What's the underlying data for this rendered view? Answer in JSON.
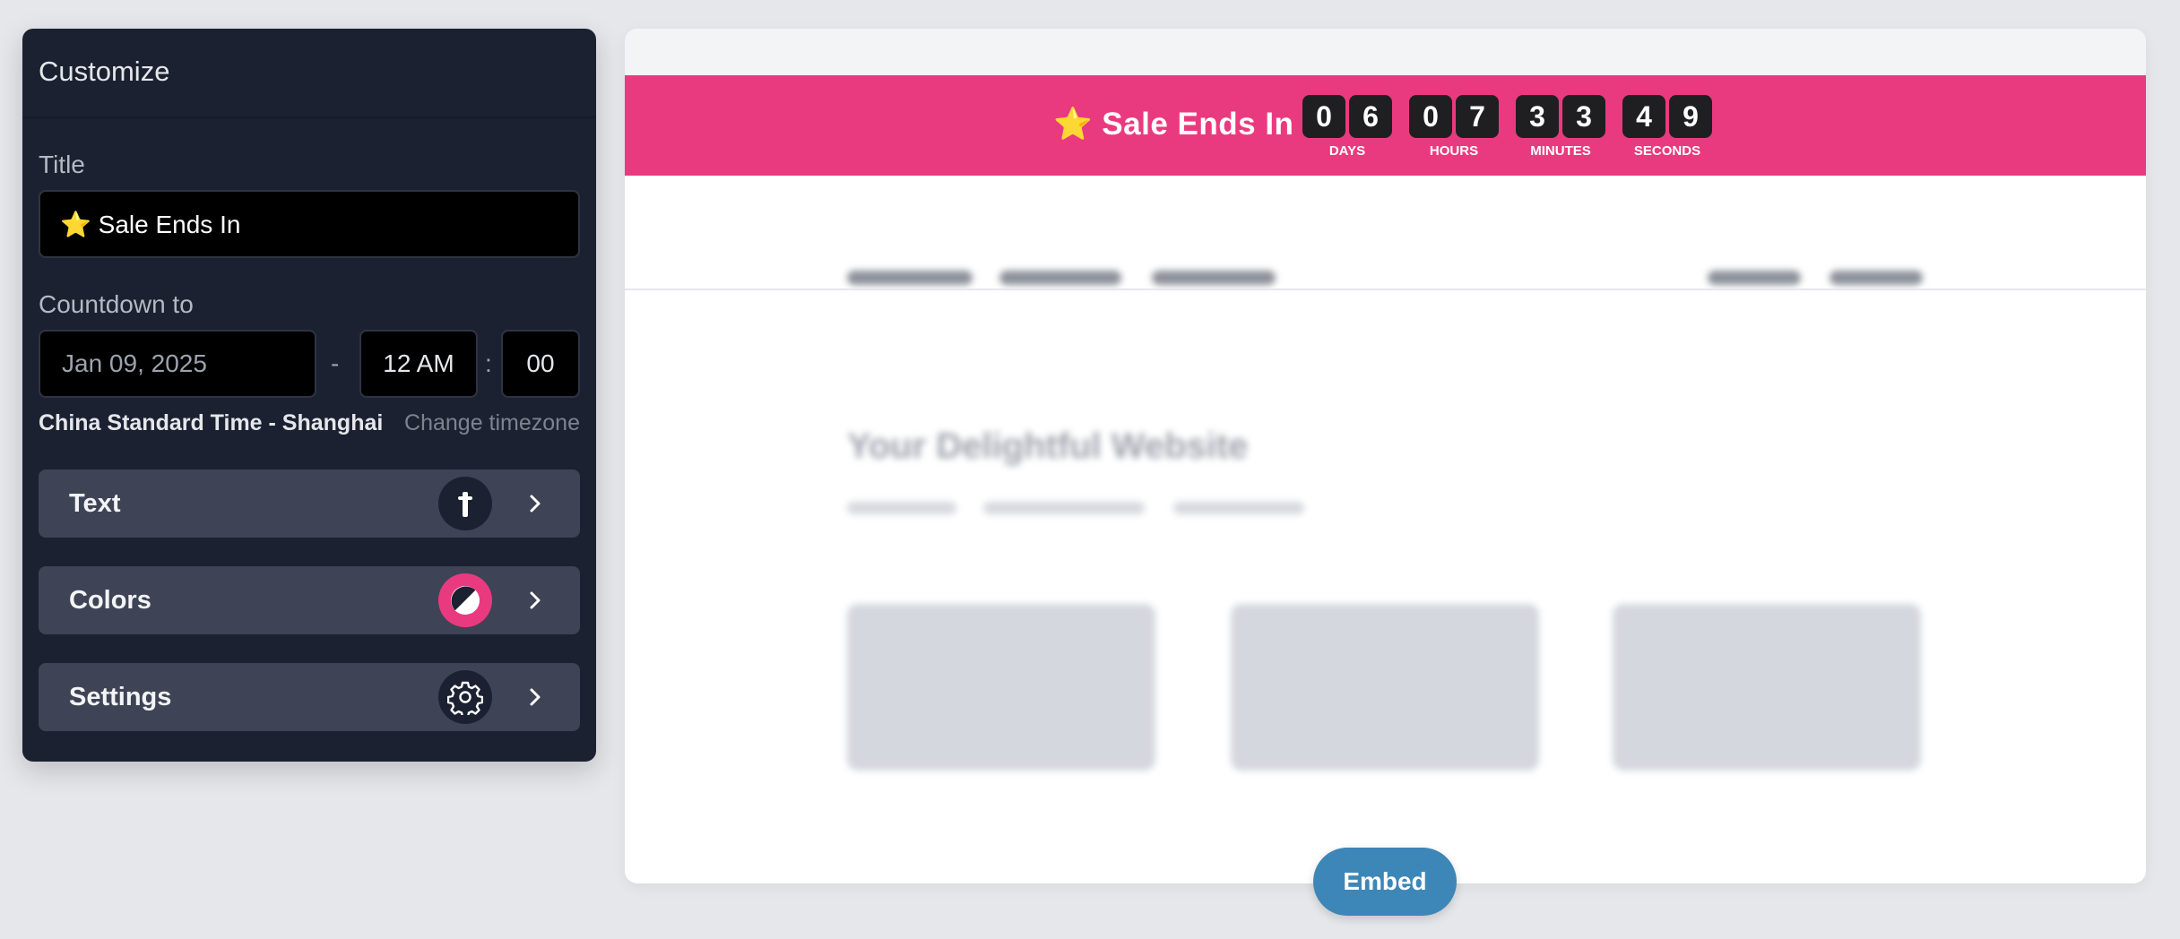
{
  "panel": {
    "title": "Customize",
    "title_label": "Title",
    "title_value": "⭐ Sale Ends In",
    "countdown_label": "Countdown to",
    "date_value": "Jan 09, 2025",
    "date_separator": "-",
    "hour_value": "12 AM",
    "time_separator": ":",
    "minute_value": "00",
    "timezone_name": "China Standard Time - Shanghai",
    "change_timezone": "Change timezone",
    "rows": [
      {
        "label": "Text",
        "icon": "text-cursor-icon"
      },
      {
        "label": "Colors",
        "icon": "color-contrast-icon"
      },
      {
        "label": "Settings",
        "icon": "gear-icon"
      }
    ]
  },
  "preview": {
    "banner_title": "⭐ Sale Ends In",
    "units": [
      {
        "digits": [
          "0",
          "6"
        ],
        "label": "DAYS"
      },
      {
        "digits": [
          "0",
          "7"
        ],
        "label": "HOURS"
      },
      {
        "digits": [
          "3",
          "3"
        ],
        "label": "MINUTES"
      },
      {
        "digits": [
          "4",
          "9"
        ],
        "label": "SECONDS"
      }
    ],
    "site_title": "Your Delightful Website",
    "embed_label": "Embed"
  },
  "colors": {
    "banner": "#ea3a7f",
    "panel_bg": "#1b2130",
    "row_bg": "#3e4455",
    "embed_button": "#3d86b8",
    "page_bg": "#e5e7eb"
  }
}
